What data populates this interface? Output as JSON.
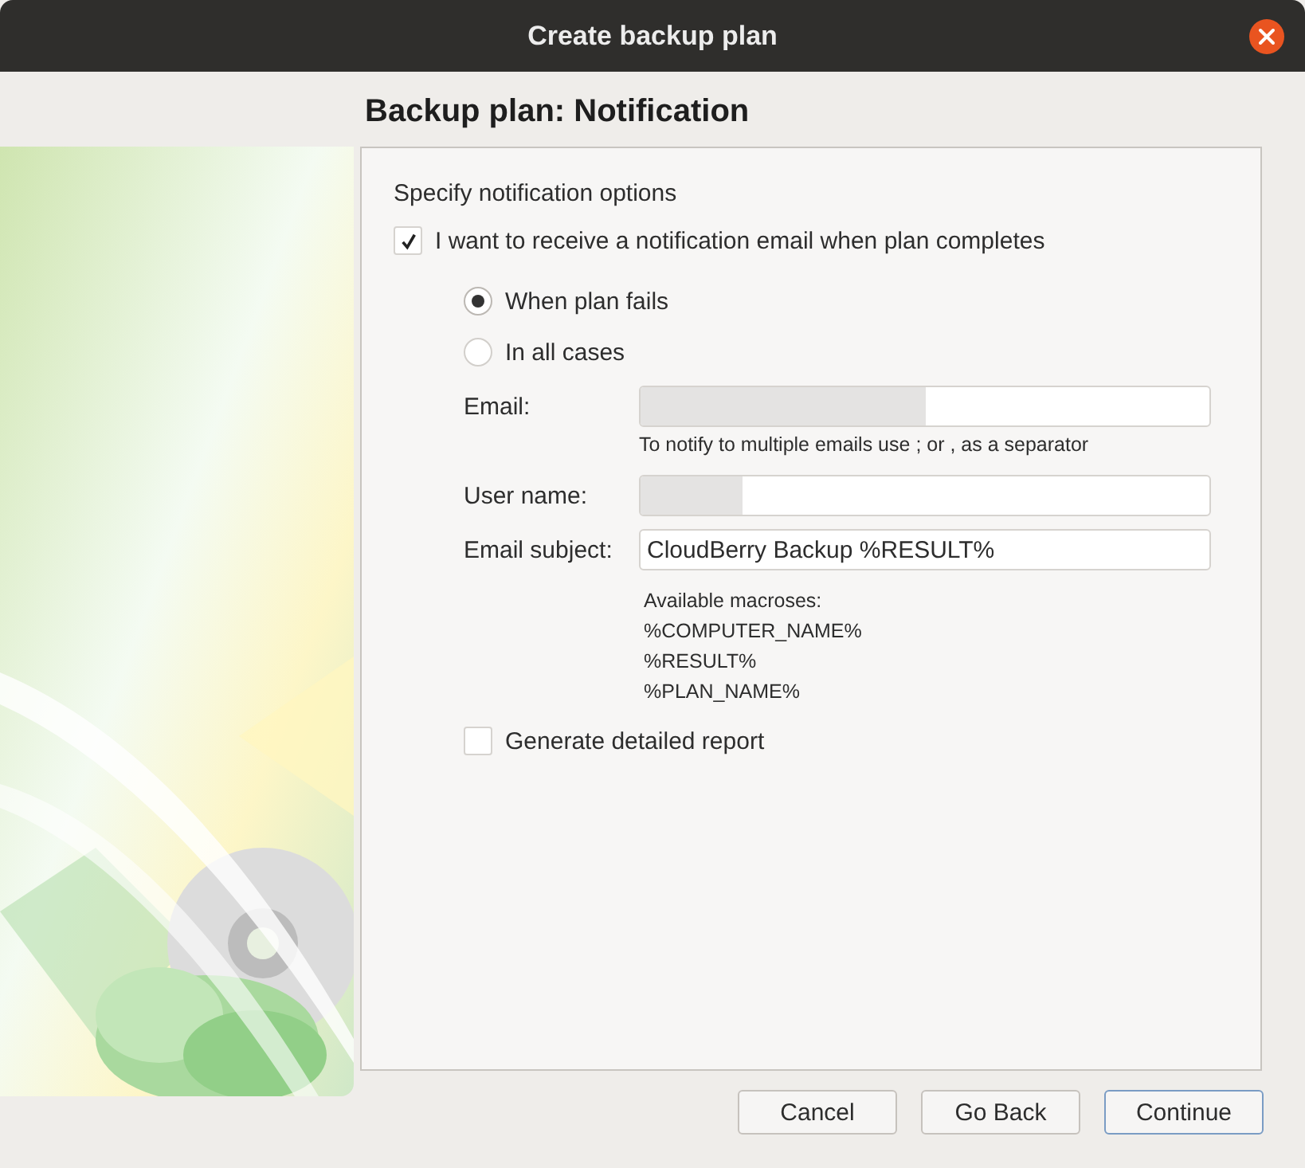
{
  "window": {
    "title": "Create backup plan"
  },
  "page_title": "Backup plan: Notification",
  "intro": "Specify notification options",
  "notify_checkbox": {
    "label": "I want to receive a notification email when plan completes",
    "checked": true
  },
  "radios": [
    {
      "label": "When plan fails",
      "selected": true
    },
    {
      "label": "In all cases",
      "selected": false
    }
  ],
  "fields": [
    {
      "label": "Email:",
      "masked": true,
      "hint": "To notify to multiple emails use ; or , as a separator"
    },
    {
      "label": "User name:",
      "masked": true
    },
    {
      "label": "Email subject:",
      "value": "CloudBerry Backup %RESULT%",
      "lines": [
        "Available macroses:",
        "%COMPUTER_NAME%",
        "%RESULT%",
        "%PLAN_NAME%"
      ]
    }
  ],
  "report_checkbox": {
    "label": "Generate detailed report",
    "checked": false
  },
  "buttons": [
    {
      "label": "Cancel",
      "default": false
    },
    {
      "label": "Go Back",
      "default": false
    },
    {
      "label": "Continue",
      "default": true
    }
  ]
}
